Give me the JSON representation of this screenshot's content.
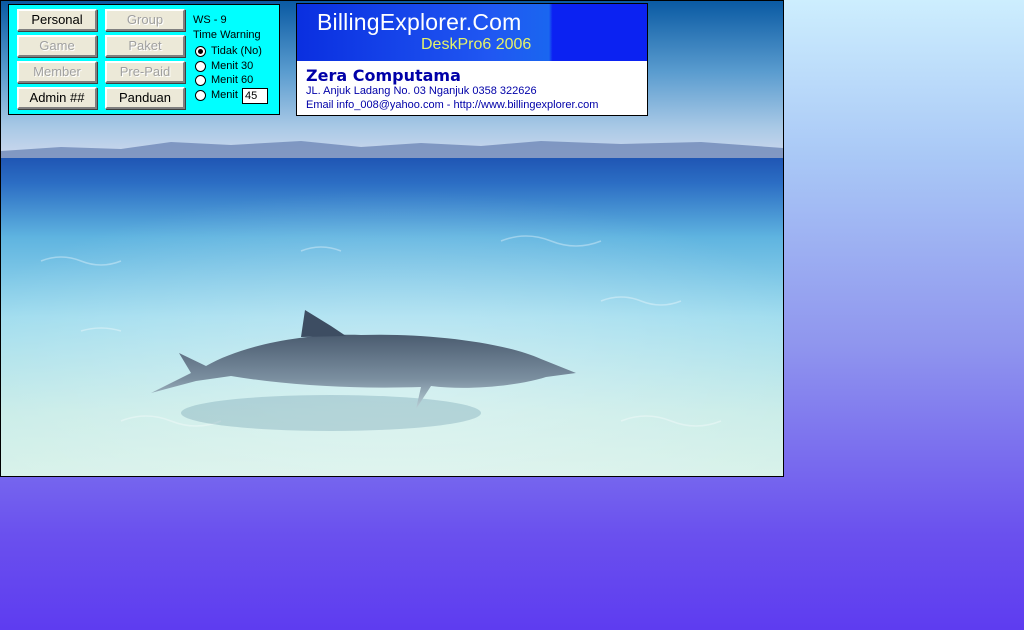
{
  "panel": {
    "buttons": {
      "personal": "Personal",
      "group": "Group",
      "game": "Game",
      "paket": "Paket",
      "member": "Member",
      "prepaid": "Pre-Paid",
      "admin": "Admin ##",
      "panduan": "Panduan"
    },
    "workstation": "WS - 9",
    "time_warning_label": "Time Warning",
    "options": [
      {
        "label": "Tidak (No)",
        "selected": true
      },
      {
        "label": "Menit  30",
        "selected": false
      },
      {
        "label": "Menit  60",
        "selected": false
      },
      {
        "label": "Menit",
        "selected": false
      }
    ],
    "custom_minutes": "45"
  },
  "banner": {
    "title": "BillingExplorer.Com",
    "subtitle": "DeskPro6 2006",
    "company": "Zera Computama",
    "address": "JL. Anjuk Ladang No. 03 Nganjuk 0358 322626",
    "contact": "Email info_008@yahoo.com - http://www.billingexplorer.com"
  },
  "colors": {
    "panel_bg": "#00ffff",
    "banner_blue": "#0b22f2",
    "banner_subtitle": "#e6f36a",
    "text_blue": "#0000a8"
  },
  "wallpaper": "dolphin-ocean-photo"
}
